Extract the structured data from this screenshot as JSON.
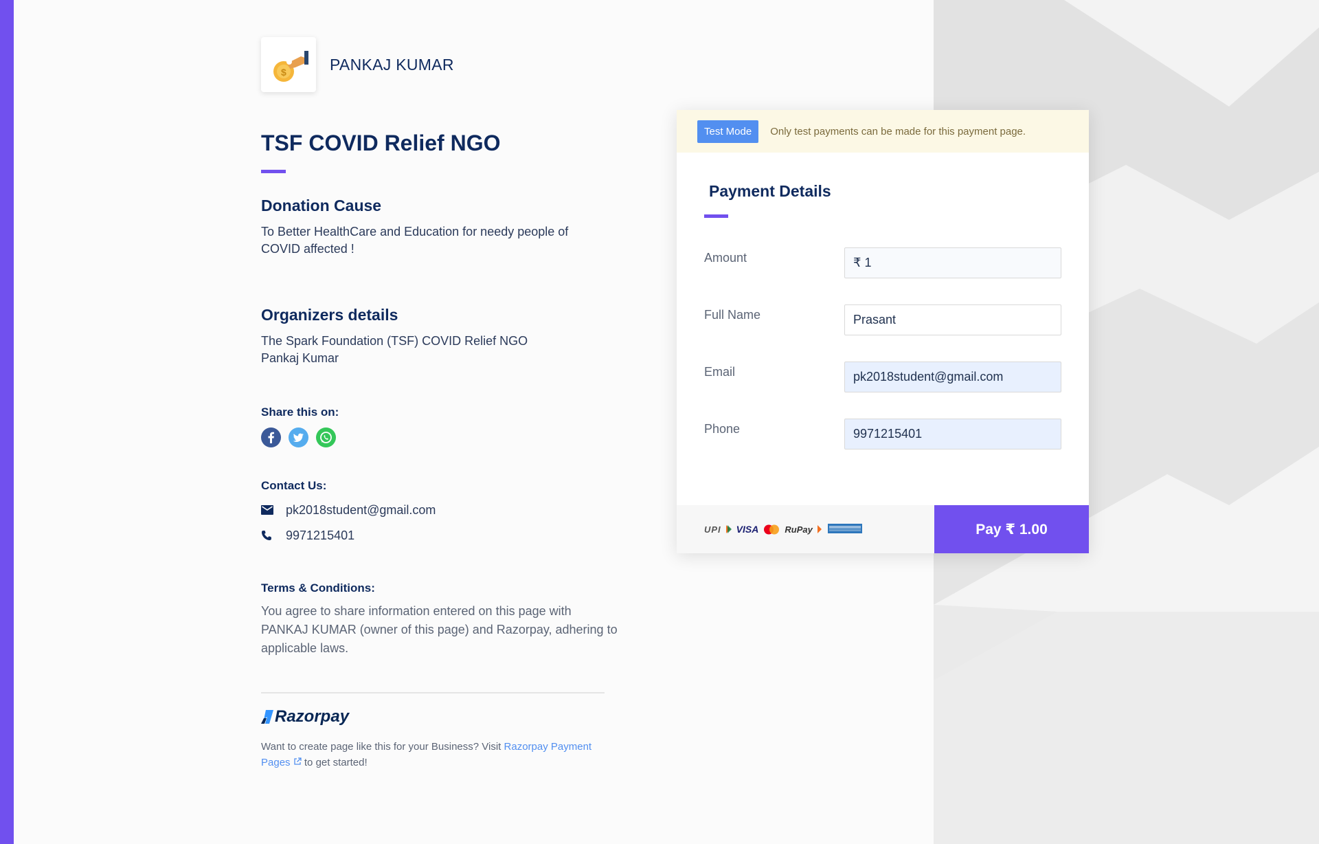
{
  "org": {
    "name": "PANKAJ KUMAR",
    "logo_icon": "donation-hand-icon"
  },
  "page": {
    "title": "TSF COVID Relief NGO"
  },
  "cause": {
    "title": "Donation Cause",
    "text": "To Better HealthCare and Education for needy people of COVID affected !"
  },
  "organizers": {
    "title": "Organizers details",
    "line1": "The Spark Foundation (TSF) COVID Relief NGO",
    "line2": "Pankaj Kumar"
  },
  "share": {
    "title": "Share this on:",
    "icons": [
      "facebook-icon",
      "twitter-icon",
      "whatsapp-icon"
    ]
  },
  "contact": {
    "title": "Contact Us:",
    "email": "pk2018student@gmail.com",
    "phone": "9971215401"
  },
  "terms": {
    "title": "Terms & Conditions:",
    "text": "You agree to share information entered on this page with PANKAJ KUMAR (owner of this page) and Razorpay, adhering to applicable laws."
  },
  "footer": {
    "brand": "Razorpay",
    "text_before": "Want to create page like this for your Business? Visit ",
    "link": "Razorpay Payment Pages",
    "text_after": " to get started!"
  },
  "banner": {
    "badge": "Test Mode",
    "text": "Only test payments can be made for this payment page."
  },
  "form": {
    "title": "Payment Details",
    "amount_label": "Amount",
    "amount_value": "₹ 1",
    "name_label": "Full Name",
    "name_value": "Prasant",
    "email_label": "Email",
    "email_value": "pk2018student@gmail.com",
    "phone_label": "Phone",
    "phone_value": "9971215401"
  },
  "payment_methods": {
    "upi": "UPI",
    "visa": "VISA",
    "rupay": "RuPay"
  },
  "pay_button": "Pay  ₹ 1.00",
  "colors": {
    "accent": "#7150ee",
    "link": "#528ff0",
    "banner": "#fcf8e5",
    "navy": "#0f2a5e"
  }
}
